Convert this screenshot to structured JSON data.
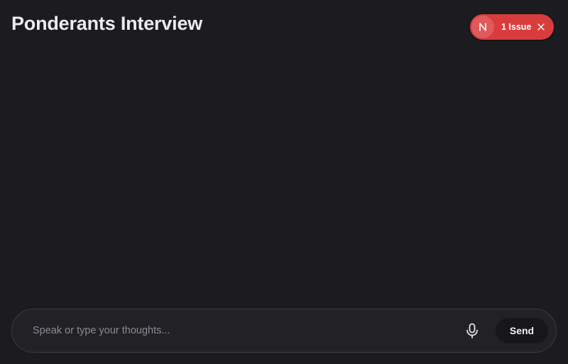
{
  "header": {
    "title": "Ponderants Interview"
  },
  "dev_indicator": {
    "logo_icon": "nextjs-n-icon",
    "issue_label": "1 Issue",
    "close_icon": "close-icon",
    "badge_color": "#d93c3c"
  },
  "composer": {
    "placeholder": "Speak or type your thoughts...",
    "value": "",
    "mic_icon": "microphone-icon",
    "send_label": "Send"
  },
  "colors": {
    "background": "#1c1c20",
    "composer_background": "#222226",
    "send_button": "#17171a"
  }
}
